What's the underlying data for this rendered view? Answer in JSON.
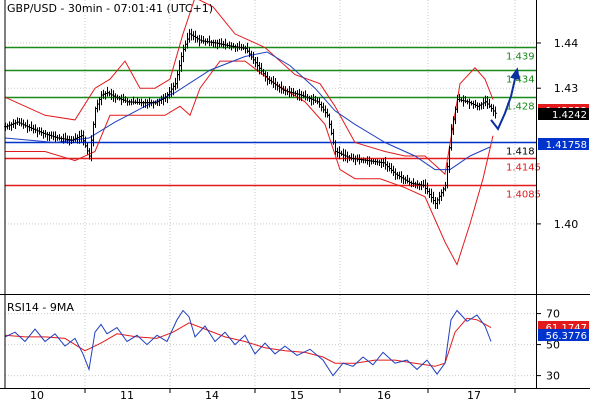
{
  "chart_data": [
    {
      "type": "candlestick",
      "title": "GBP/USD - 30min - 07:01:41 (UTC+1)",
      "ylim": [
        1.3845,
        1.4495
      ],
      "y_ticks": [
        "1.40",
        "1.43",
        "1.44"
      ],
      "x_ticks": [
        "10",
        "11",
        "14",
        "15",
        "16",
        "17"
      ],
      "grid": true,
      "colors": {
        "candles": "#000000",
        "bollinger": "#e31a1c",
        "moving_average": "#1f3fbf",
        "resistance": "#1a8a1a",
        "support": "#e31a1c",
        "pivot": "#0033cc",
        "projection": "#0b2f9e",
        "current_badge": "#000000",
        "bollinger_badge": "#e31a1c",
        "pivot_badge": "#0033cc"
      },
      "levels": [
        {
          "value": 1.439,
          "label": "1.439",
          "role": "resistance"
        },
        {
          "value": 1.434,
          "label": "1.434",
          "role": "resistance"
        },
        {
          "value": 1.428,
          "label": "1.428",
          "role": "resistance"
        },
        {
          "value": 1.418,
          "label": "1.418",
          "role": "pivot"
        },
        {
          "value": 1.4145,
          "label": "1.4145",
          "role": "support"
        },
        {
          "value": 1.4085,
          "label": "1.4085",
          "role": "support"
        }
      ],
      "badges": [
        {
          "value": 1.42522,
          "label": "1.42522",
          "role": "bollinger_badge"
        },
        {
          "value": 1.4242,
          "label": "1.4242",
          "role": "current_badge"
        },
        {
          "value": 1.41758,
          "label": "1.41758",
          "role": "pivot_badge"
        }
      ],
      "price_path": [
        [
          0,
          1.4215
        ],
        [
          12,
          1.4225
        ],
        [
          25,
          1.4212
        ],
        [
          38,
          1.42
        ],
        [
          52,
          1.419
        ],
        [
          66,
          1.4185
        ],
        [
          76,
          1.4195
        ],
        [
          84,
          1.415
        ],
        [
          90,
          1.4255
        ],
        [
          96,
          1.4285
        ],
        [
          102,
          1.429
        ],
        [
          110,
          1.428
        ],
        [
          122,
          1.427
        ],
        [
          135,
          1.4268
        ],
        [
          150,
          1.4268
        ],
        [
          160,
          1.428
        ],
        [
          170,
          1.431
        ],
        [
          177,
          1.438
        ],
        [
          184,
          1.442
        ],
        [
          195,
          1.4405
        ],
        [
          210,
          1.44
        ],
        [
          225,
          1.4393
        ],
        [
          240,
          1.4388
        ],
        [
          252,
          1.435
        ],
        [
          262,
          1.432
        ],
        [
          278,
          1.4295
        ],
        [
          295,
          1.4285
        ],
        [
          312,
          1.427
        ],
        [
          322,
          1.424
        ],
        [
          330,
          1.416
        ],
        [
          345,
          1.4145
        ],
        [
          362,
          1.414
        ],
        [
          378,
          1.4135
        ],
        [
          390,
          1.411
        ],
        [
          405,
          1.409
        ],
        [
          418,
          1.4085
        ],
        [
          430,
          1.4045
        ],
        [
          440,
          1.4085
        ],
        [
          446,
          1.421
        ],
        [
          452,
          1.4275
        ],
        [
          462,
          1.427
        ],
        [
          472,
          1.426
        ],
        [
          480,
          1.427
        ],
        [
          486,
          1.4255
        ],
        [
          491,
          1.4242
        ]
      ],
      "bollinger_upper": [
        [
          0,
          1.428
        ],
        [
          40,
          1.424
        ],
        [
          70,
          1.423
        ],
        [
          90,
          1.43
        ],
        [
          105,
          1.432
        ],
        [
          120,
          1.436
        ],
        [
          135,
          1.43
        ],
        [
          150,
          1.43
        ],
        [
          165,
          1.432
        ],
        [
          178,
          1.442
        ],
        [
          190,
          1.45
        ],
        [
          208,
          1.448
        ],
        [
          230,
          1.442
        ],
        [
          260,
          1.439
        ],
        [
          290,
          1.433
        ],
        [
          315,
          1.431
        ],
        [
          330,
          1.426
        ],
        [
          350,
          1.418
        ],
        [
          380,
          1.416
        ],
        [
          400,
          1.415
        ],
        [
          420,
          1.415
        ],
        [
          440,
          1.411
        ],
        [
          455,
          1.431
        ],
        [
          470,
          1.4345
        ],
        [
          480,
          1.432
        ],
        [
          488,
          1.4275
        ]
      ],
      "bollinger_lower": [
        [
          0,
          1.416
        ],
        [
          40,
          1.416
        ],
        [
          70,
          1.414
        ],
        [
          90,
          1.416
        ],
        [
          105,
          1.424
        ],
        [
          120,
          1.424
        ],
        [
          135,
          1.424
        ],
        [
          160,
          1.424
        ],
        [
          175,
          1.426
        ],
        [
          185,
          1.424
        ],
        [
          195,
          1.43
        ],
        [
          215,
          1.436
        ],
        [
          240,
          1.436
        ],
        [
          270,
          1.431
        ],
        [
          300,
          1.427
        ],
        [
          320,
          1.422
        ],
        [
          335,
          1.412
        ],
        [
          350,
          1.41
        ],
        [
          375,
          1.41
        ],
        [
          400,
          1.408
        ],
        [
          420,
          1.406
        ],
        [
          440,
          1.396
        ],
        [
          452,
          1.391
        ],
        [
          465,
          1.4
        ],
        [
          478,
          1.41
        ],
        [
          488,
          1.4195
        ]
      ],
      "moving_average": [
        [
          0,
          1.419
        ],
        [
          50,
          1.418
        ],
        [
          84,
          1.419
        ],
        [
          110,
          1.4225
        ],
        [
          140,
          1.426
        ],
        [
          170,
          1.429
        ],
        [
          205,
          1.434
        ],
        [
          240,
          1.437
        ],
        [
          262,
          1.438
        ],
        [
          285,
          1.435
        ],
        [
          310,
          1.43
        ],
        [
          330,
          1.425
        ],
        [
          350,
          1.422
        ],
        [
          380,
          1.418
        ],
        [
          410,
          1.415
        ],
        [
          430,
          1.412
        ],
        [
          445,
          1.412
        ],
        [
          465,
          1.415
        ],
        [
          485,
          1.417
        ]
      ],
      "projection": [
        [
          486,
          1.423
        ],
        [
          493,
          1.421
        ],
        [
          500,
          1.4245
        ],
        [
          506,
          1.4282
        ],
        [
          512,
          1.434
        ]
      ]
    },
    {
      "type": "line",
      "title": "RSI14 - 9MA",
      "ylim": [
        22,
        82
      ],
      "y_ticks": [
        "70",
        "50",
        "30"
      ],
      "grid": true,
      "colors": {
        "rsi": "#1f3fbf",
        "ma": "#e31a1c",
        "rsi_badge": "#0033cc",
        "ma_badge": "#e31a1c"
      },
      "badges": [
        {
          "value": 61.1747,
          "label": "61.1747",
          "role": "ma_badge"
        },
        {
          "value": 56.3776,
          "label": "56.3776",
          "role": "rsi_badge"
        }
      ],
      "rsi": [
        [
          0,
          55
        ],
        [
          10,
          58
        ],
        [
          20,
          52
        ],
        [
          30,
          60
        ],
        [
          40,
          52
        ],
        [
          50,
          57
        ],
        [
          60,
          49
        ],
        [
          70,
          54
        ],
        [
          78,
          44
        ],
        [
          84,
          34
        ],
        [
          90,
          58
        ],
        [
          96,
          63
        ],
        [
          102,
          57
        ],
        [
          112,
          61
        ],
        [
          122,
          52
        ],
        [
          132,
          56
        ],
        [
          142,
          50
        ],
        [
          152,
          56
        ],
        [
          162,
          52
        ],
        [
          172,
          66
        ],
        [
          178,
          72
        ],
        [
          184,
          68
        ],
        [
          190,
          55
        ],
        [
          200,
          62
        ],
        [
          210,
          52
        ],
        [
          220,
          58
        ],
        [
          230,
          50
        ],
        [
          240,
          56
        ],
        [
          250,
          44
        ],
        [
          260,
          51
        ],
        [
          270,
          44
        ],
        [
          280,
          49
        ],
        [
          292,
          43
        ],
        [
          305,
          47
        ],
        [
          318,
          40
        ],
        [
          328,
          30
        ],
        [
          338,
          38
        ],
        [
          348,
          36
        ],
        [
          358,
          42
        ],
        [
          368,
          37
        ],
        [
          378,
          45
        ],
        [
          390,
          38
        ],
        [
          402,
          40
        ],
        [
          412,
          34
        ],
        [
          422,
          40
        ],
        [
          432,
          31
        ],
        [
          440,
          38
        ],
        [
          446,
          66
        ],
        [
          452,
          72
        ],
        [
          462,
          65
        ],
        [
          472,
          69
        ],
        [
          480,
          62
        ],
        [
          486,
          52
        ]
      ],
      "ma": [
        [
          0,
          56
        ],
        [
          20,
          55
        ],
        [
          40,
          55
        ],
        [
          60,
          54
        ],
        [
          80,
          46
        ],
        [
          96,
          51
        ],
        [
          112,
          57
        ],
        [
          132,
          55
        ],
        [
          152,
          54
        ],
        [
          168,
          58
        ],
        [
          184,
          64
        ],
        [
          200,
          60
        ],
        [
          220,
          55
        ],
        [
          240,
          52
        ],
        [
          260,
          48
        ],
        [
          280,
          46
        ],
        [
          300,
          45
        ],
        [
          318,
          42
        ],
        [
          330,
          38
        ],
        [
          350,
          38
        ],
        [
          370,
          40
        ],
        [
          390,
          40
        ],
        [
          410,
          38
        ],
        [
          430,
          36
        ],
        [
          440,
          38
        ],
        [
          450,
          58
        ],
        [
          462,
          67
        ],
        [
          472,
          66
        ],
        [
          486,
          61
        ]
      ]
    }
  ]
}
